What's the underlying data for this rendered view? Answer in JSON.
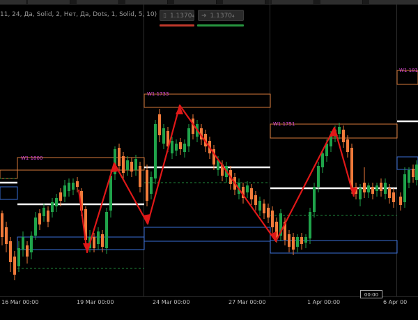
{
  "tabs": [
    {
      "label": ""
    },
    {
      "label": ""
    },
    {
      "label": ""
    },
    {
      "label": ""
    },
    {
      "label": ""
    },
    {
      "label": ""
    },
    {
      "label": ""
    },
    {
      "label": ""
    }
  ],
  "indicator_params": "11, 24, Да, Solid, 2, Нет, Да, Dots, 1, Solid, 5, 10)",
  "sell_button": {
    "icon": "sell-arrow-icon",
    "price": "1.1370₄"
  },
  "buy_button": {
    "icon": "buy-arrow-icon",
    "price": "1.1370₄"
  },
  "colors": {
    "background": "#000000",
    "bull_candle": "#1fa34a",
    "bear_candle": "#f07a3a",
    "zigzag": "#e01818",
    "resistance_zone": "#d87a3a",
    "support_zone": "#3a6fd8",
    "zone_label": "#d84ad8",
    "level_line": "#ffffff",
    "sell_underline": "#c0392b",
    "buy_underline": "#27963f"
  },
  "zones": [
    {
      "label": "W1 1800"
    },
    {
      "label": "W1 1733"
    },
    {
      "label": "W1 1751"
    },
    {
      "label": "W1 181"
    }
  ],
  "time_axis": {
    "labels": [
      "16 Mar 00:00",
      "19 Mar 00:00",
      "24 Mar 00:00",
      "27 Mar 00:00",
      "1 Apr 00:00",
      "6 Apr 00"
    ],
    "crosshair_time": "00:00"
  }
}
